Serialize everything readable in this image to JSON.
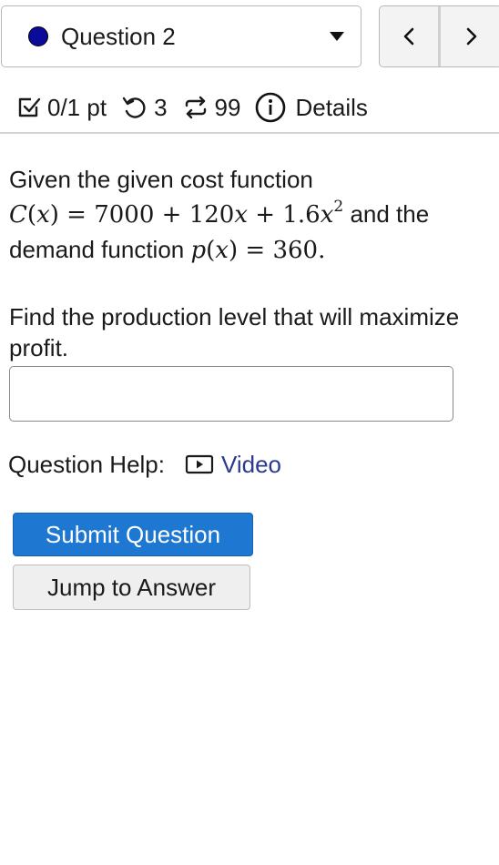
{
  "header": {
    "question_label": "Question 2",
    "status_color": "#0b0b9a",
    "prev_icon": "chevron-left-icon",
    "next_icon": "chevron-right-icon"
  },
  "stats": {
    "score": "0/1 pt",
    "attempts": "3",
    "versions": "99",
    "details_label": "Details"
  },
  "question": {
    "intro": "Given the given cost function",
    "cost_function": {
      "lhs_name": "C",
      "lhs_var": "x",
      "c0": "7000",
      "c1": "120",
      "c1_var": "x",
      "c2": "1.6",
      "c2_var": "x",
      "exp": "2"
    },
    "connector": "and the",
    "demand_intro": "demand function",
    "demand_function": {
      "lhs_name": "p",
      "lhs_var": "x",
      "value": "360"
    },
    "prompt": "Find the production level that will maximize profit.",
    "answer_value": "",
    "answer_placeholder": ""
  },
  "help": {
    "label": "Question Help:",
    "video_label": "Video",
    "link_color": "#2a3b8f"
  },
  "actions": {
    "submit_label": "Submit Question",
    "jump_label": "Jump to Answer",
    "submit_color": "#1e78d2"
  }
}
